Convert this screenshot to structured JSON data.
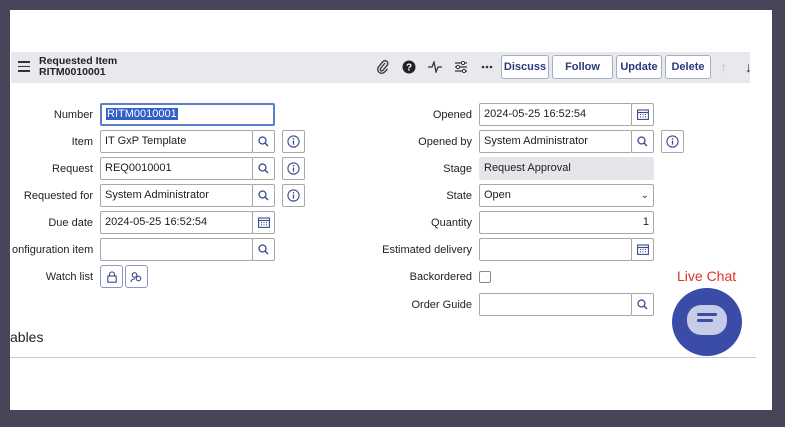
{
  "header": {
    "title": "Requested Item",
    "number": "RITM0010001",
    "buttons": {
      "discuss": "Discuss",
      "follow": "Follow",
      "update": "Update",
      "delete": "Delete"
    }
  },
  "left": {
    "number": {
      "label": "Number",
      "value": "RITM0010001"
    },
    "item": {
      "label": "Item",
      "value": "IT GxP Template"
    },
    "request": {
      "label": "Request",
      "value": "REQ0010001"
    },
    "requested_for": {
      "label": "Requested for",
      "value": "System Administrator"
    },
    "due_date": {
      "label": "Due date",
      "value": "2024-05-25 16:52:54"
    },
    "config_item": {
      "label": "onfiguration item",
      "value": ""
    },
    "watch_list": {
      "label": "Watch list"
    }
  },
  "right": {
    "opened": {
      "label": "Opened",
      "value": "2024-05-25 16:52:54"
    },
    "opened_by": {
      "label": "Opened by",
      "value": "System Administrator"
    },
    "stage": {
      "label": "Stage",
      "value": "Request Approval"
    },
    "state": {
      "label": "State",
      "value": "Open"
    },
    "quantity": {
      "label": "Quantity",
      "value": "1"
    },
    "estimated_delivery": {
      "label": "Estimated delivery",
      "value": ""
    },
    "backordered": {
      "label": "Backordered",
      "checked": false
    },
    "order_guide": {
      "label": "Order Guide",
      "value": ""
    }
  },
  "section": {
    "variables": "ables"
  },
  "chat": {
    "label": "Live Chat"
  }
}
